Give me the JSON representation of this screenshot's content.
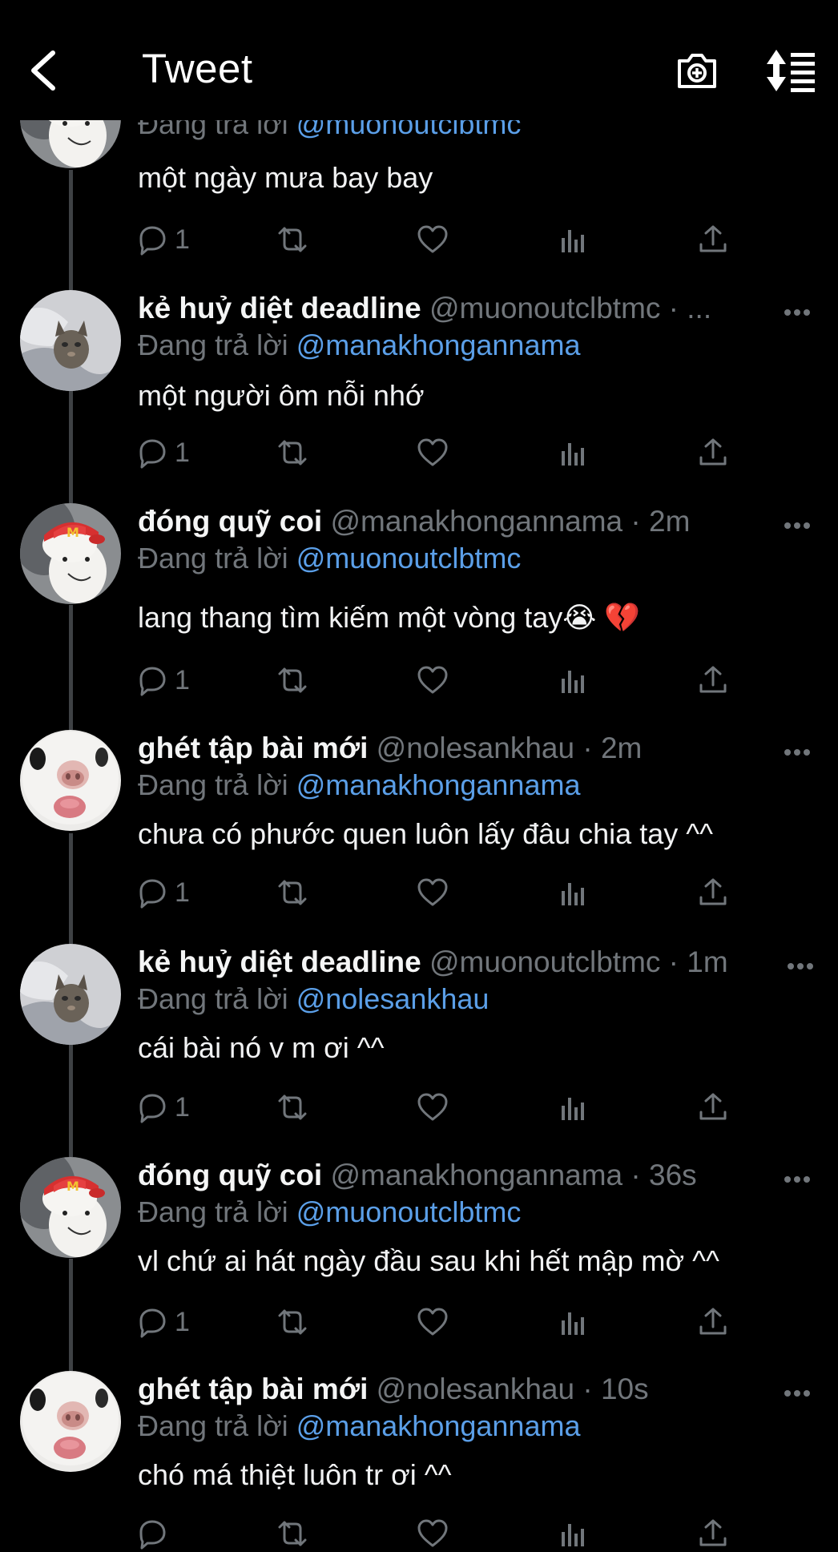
{
  "header": {
    "title": "Tweet"
  },
  "reply_prefix": "Đang trả lời",
  "tweets": [
    {
      "name": "",
      "handle": "",
      "time": "",
      "reply_to": "@muonoutclbtmc",
      "text": "một ngày mưa bay bay",
      "replies": "1",
      "avatar": "rabbit"
    },
    {
      "name": "kẻ huỷ diệt deadline",
      "handle": "@muonoutclbtmc",
      "time": "· ...",
      "reply_to": "@manakhongannama",
      "text": "một người ôm nỗi nhớ",
      "replies": "1",
      "avatar": "cat"
    },
    {
      "name": "đóng quỹ coi",
      "handle": "@manakhongannama",
      "time": "· 2m",
      "reply_to": "@muonoutclbtmc",
      "text": "lang thang tìm kiếm một vòng tay😭 💔",
      "replies": "1",
      "avatar": "rabbit"
    },
    {
      "name": "ghét tập bài mới",
      "handle": "@nolesankhau",
      "time": "· 2m",
      "reply_to": "@manakhongannama",
      "text": "chưa có phước quen luôn lấy đâu chia tay ^^",
      "replies": "1",
      "avatar": "guinea"
    },
    {
      "name": "kẻ huỷ diệt deadline",
      "handle": "@muonoutclbtmc",
      "time": "· 1m",
      "reply_to": "@nolesankhau",
      "text": "cái bài nó v m ơi ^^",
      "replies": "1",
      "avatar": "cat"
    },
    {
      "name": "đóng quỹ coi",
      "handle": "@manakhongannama",
      "time": "· 36s",
      "reply_to": "@muonoutclbtmc",
      "text": "vl chứ ai hát ngày đầu sau khi hết mập mờ ^^",
      "replies": "1",
      "avatar": "rabbit"
    },
    {
      "name": "ghét tập bài mới",
      "handle": "@nolesankhau",
      "time": "· 10s",
      "reply_to": "@manakhongannama",
      "text": "chó má thiệt luôn tr ơi ^^",
      "replies": "",
      "avatar": "guinea"
    }
  ],
  "colors": {
    "background": "#000000",
    "text": "#e7e9ea",
    "muted": "#71767b",
    "mention": "#5b9fe8",
    "thread_line": "#3e4144"
  }
}
